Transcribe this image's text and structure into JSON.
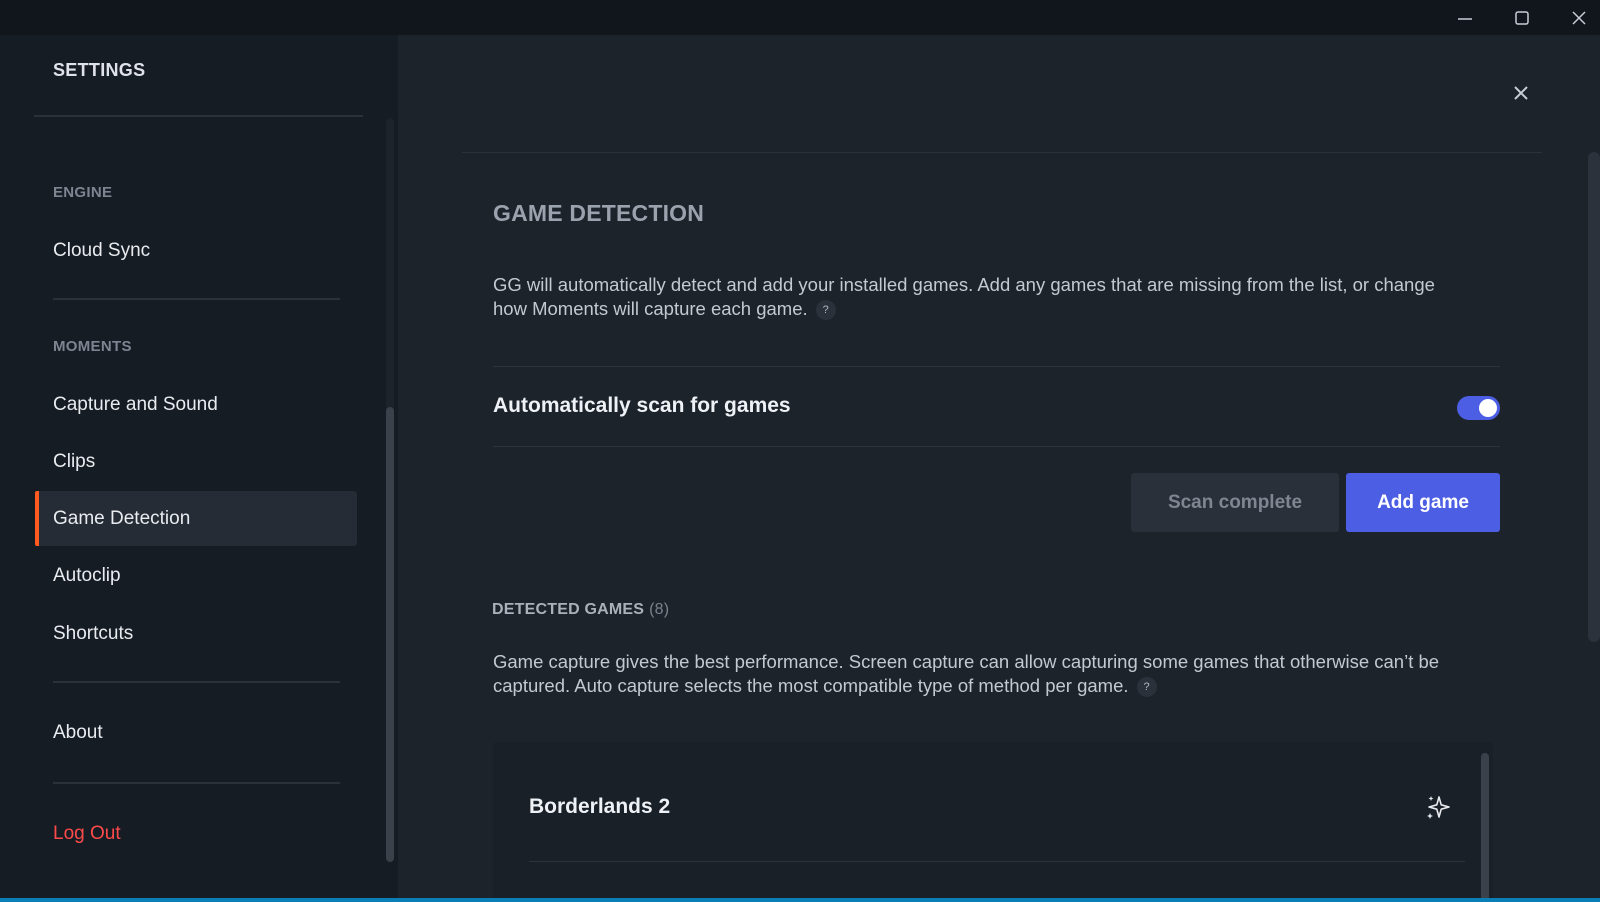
{
  "window": {
    "icons": {
      "minimize": "minimize-icon",
      "maximize": "maximize-icon",
      "close": "close-icon"
    }
  },
  "sidebar": {
    "title": "SETTINGS",
    "sections": {
      "engine": "ENGINE",
      "moments": "MOMENTS"
    },
    "items": {
      "cloud_sync": "Cloud Sync",
      "capture_and_sound": "Capture and Sound",
      "clips": "Clips",
      "game_detection": "Game Detection",
      "autoclip": "Autoclip",
      "shortcuts": "Shortcuts",
      "about": "About",
      "log_out": "Log Out"
    },
    "active_item": "Game Detection"
  },
  "main": {
    "title": "GAME DETECTION",
    "description": "GG will automatically detect and add your installed games. Add any games that are missing from the list, or change how Moments will capture each game.",
    "help_glyph": "?",
    "auto_scan": {
      "label": "Automatically scan for games",
      "enabled": true
    },
    "buttons": {
      "scan": "Scan complete",
      "add": "Add game"
    },
    "detected": {
      "label": "DETECTED GAMES",
      "count": "(8)",
      "description": "Game capture gives the best performance. Screen capture can allow capturing some games that otherwise can’t be captured. Auto capture selects the most compatible type of method per game."
    },
    "games": [
      {
        "name": "Borderlands 2",
        "icon": "sparkle-icon"
      }
    ]
  },
  "colors": {
    "accent": "#4b5ee4",
    "active_indicator": "#ff5a1f",
    "logout": "#ff4a4a"
  }
}
